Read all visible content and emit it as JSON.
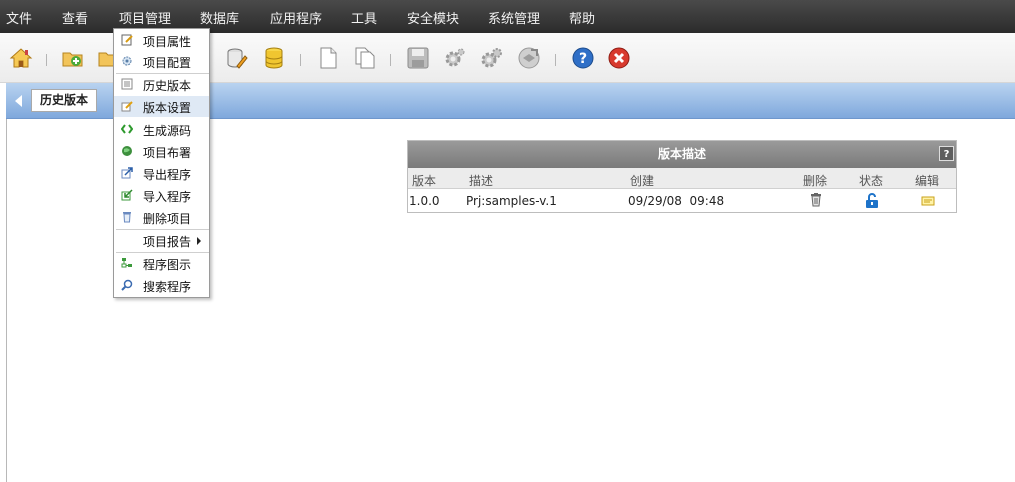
{
  "menubar": {
    "items": [
      "文件",
      "查看",
      "项目管理",
      "数据库",
      "应用程序",
      "工具",
      "安全模块",
      "系统管理",
      "帮助"
    ]
  },
  "toolbar": {
    "icons": [
      "home-icon",
      "open-project-icon",
      "project-folder-icon",
      "database-edit-icon",
      "database-icon",
      "new-document-icon",
      "copy-document-icon",
      "save-icon",
      "settings-icon",
      "settings-advanced-icon",
      "deploy-icon",
      "help-icon",
      "close-icon"
    ]
  },
  "header": {
    "title": "历史版本"
  },
  "dropdown": {
    "items": [
      {
        "label": "项目属性",
        "icon": "properties-icon"
      },
      {
        "label": "项目配置",
        "icon": "config-icon"
      },
      {
        "label": "历史版本",
        "icon": "history-icon"
      },
      {
        "label": "版本设置",
        "icon": "version-settings-icon",
        "highlighted": true
      },
      {
        "label": "生成源码",
        "icon": "code-icon"
      },
      {
        "label": "项目布署",
        "icon": "deploy-globe-icon"
      },
      {
        "label": "导出程序",
        "icon": "export-icon"
      },
      {
        "label": "导入程序",
        "icon": "import-icon"
      },
      {
        "label": "删除项目",
        "icon": "trash-icon"
      },
      {
        "label": "项目报告",
        "icon": "",
        "submenu": true
      },
      {
        "label": "程序图示",
        "icon": "diagram-icon"
      },
      {
        "label": "搜索程序",
        "icon": "search-icon"
      }
    ]
  },
  "panel": {
    "title": "版本描述",
    "help": "?",
    "columns": [
      "版本",
      "描述",
      "创建",
      "删除",
      "状态",
      "编辑"
    ],
    "rows": [
      {
        "version": "1.0.0",
        "description": "Prj:samples-v.1",
        "created": "09/29/08  09:48"
      }
    ]
  },
  "colors": {
    "menubar": "#333333",
    "header_blue": "#8fb3e0",
    "panel_head": "#888888",
    "lock": "#1e73c9",
    "edit": "#e6c12a"
  }
}
